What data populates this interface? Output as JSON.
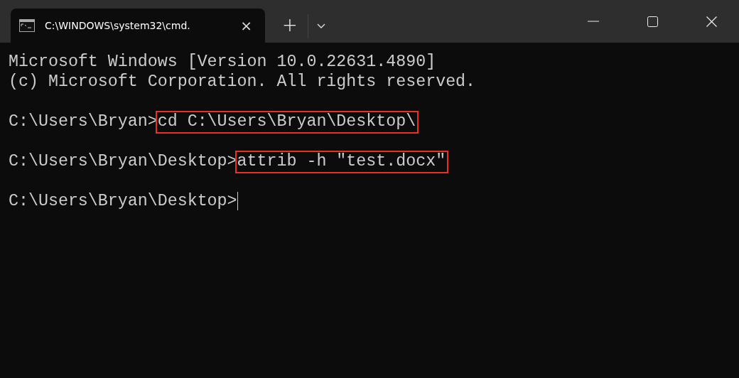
{
  "window": {
    "tab_title": "C:\\WINDOWS\\system32\\cmd.",
    "tab_close": "×",
    "new_tab": "+"
  },
  "terminal": {
    "lines": [
      {
        "kind": "text",
        "text": "Microsoft Windows [Version 10.0.22631.4890]"
      },
      {
        "kind": "text",
        "text": "(c) Microsoft Corporation. All rights reserved."
      },
      {
        "kind": "blank"
      },
      {
        "kind": "prompt",
        "prompt": "C:\\Users\\Bryan>",
        "command": "cd C:\\Users\\Bryan\\Desktop\\",
        "highlighted": true,
        "cursor": false
      },
      {
        "kind": "blank"
      },
      {
        "kind": "prompt",
        "prompt": "C:\\Users\\Bryan\\Desktop>",
        "command": "attrib -h \"test.docx\"",
        "highlighted": true,
        "cursor": false
      },
      {
        "kind": "blank"
      },
      {
        "kind": "prompt",
        "prompt": "C:\\Users\\Bryan\\Desktop>",
        "cursor": true
      }
    ]
  }
}
